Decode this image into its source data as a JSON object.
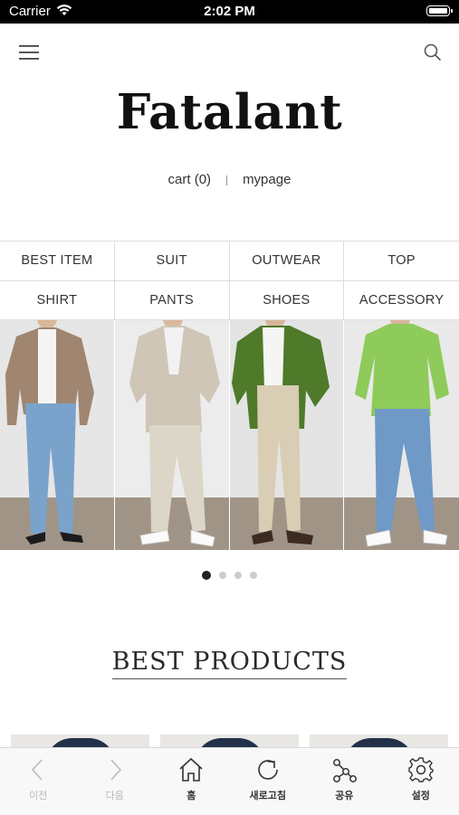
{
  "status_bar": {
    "carrier": "Carrier",
    "time": "2:02 PM"
  },
  "header": {
    "logo": "Fatalant",
    "cart_label": "cart (0)",
    "mypage_label": "mypage"
  },
  "categories": [
    "BEST ITEM",
    "SUIT",
    "OUTWEAR",
    "TOP",
    "SHIRT",
    "PANTS",
    "SHOES",
    "ACCESSORY"
  ],
  "banner": {
    "slide_count": 4,
    "active_slide": 1
  },
  "best_products_title": "BEST PRODUCTS",
  "toolbar": {
    "back_label": "이전",
    "forward_label": "다음",
    "home_label": "홈",
    "refresh_label": "새로고침",
    "share_label": "공유",
    "settings_label": "설정"
  },
  "colors": {
    "status_bar": "#000000",
    "logo": "#111111",
    "active_dot": "#222222",
    "inactive_dot": "#cccccc",
    "toolbar_bg": "#f8f8f8"
  }
}
